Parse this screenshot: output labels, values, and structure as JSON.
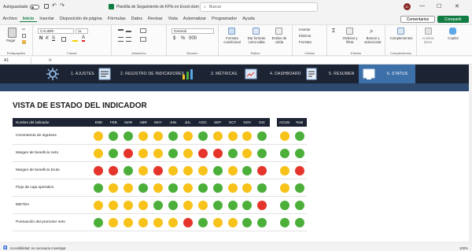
{
  "titlebar": {
    "autosave": "Autoguardado",
    "doc_title": "Plantilla de Seguimiento de KPIs en Excel.xlsm - Solo lec...",
    "search_placeholder": "Buscar",
    "avatar_initials": "JL"
  },
  "tabs": [
    "Archivo",
    "Inicio",
    "Insertar",
    "Disposición de página",
    "Fórmulas",
    "Datos",
    "Revisar",
    "Vista",
    "Automatizar",
    "Programador",
    "Ayuda"
  ],
  "active_tab": "Inicio",
  "actions": {
    "comments": "Comentarios",
    "share": "Compartir"
  },
  "ribbon": {
    "clipboard": {
      "paste": "Pegar",
      "label": "Portapapeles"
    },
    "font": {
      "name": "CALIBRI",
      "size": "11",
      "label": "Fuente"
    },
    "alignment": {
      "label": "Alineación"
    },
    "number": {
      "format": "General",
      "label": "Número"
    },
    "styles": {
      "conditional": "Formato condicional",
      "table": "Dar formato como tabla",
      "cell": "Estilos de celda",
      "label": "Estilos"
    },
    "cells": {
      "insert": "Insertar",
      "delete": "Eliminar",
      "format": "Formato",
      "label": "Celdas"
    },
    "editing": {
      "sort": "Ordenar y filtrar",
      "find": "Buscar y seleccionar",
      "label": "Edición"
    },
    "addins": {
      "addins": "Complementos",
      "label": "Complementos"
    },
    "data_analysis": "Analizar datos",
    "copilot": "Copilot"
  },
  "formula_bar": {
    "cell_ref": "A1",
    "fx": "fx"
  },
  "nav": {
    "items": [
      {
        "label": "1. AJUSTES"
      },
      {
        "label": "2. REGISTRO DE INDICADORES"
      },
      {
        "label": "3. MÉTRICAS"
      },
      {
        "label": "4. DASHBOARD"
      },
      {
        "label": "5. RESUMEN"
      },
      {
        "label": "6. STATUS"
      }
    ],
    "active_index": 5
  },
  "page_title": "VISTA DE ESTADO DEL INDICADOR",
  "table": {
    "name_header": "Nombre del indicador",
    "months": [
      "ENE",
      "FEB",
      "MAR",
      "ABR",
      "MAY",
      "JUN",
      "JUL",
      "AGO",
      "SEP",
      "OCT",
      "NOV",
      "DIC"
    ],
    "acum_header": "ACUM",
    "total_header": "Total",
    "rows": [
      {
        "name": "Crecimiento de ingresos",
        "status": [
          "y",
          "g",
          "g",
          "y",
          "y",
          "g",
          "y",
          "g",
          "y",
          "y",
          "y",
          "g"
        ],
        "acum": "y",
        "total": "g"
      },
      {
        "name": "Margen de beneficio neto",
        "status": [
          "y",
          "g",
          "r",
          "y",
          "y",
          "g",
          "y",
          "r",
          "r",
          "g",
          "y",
          "g"
        ],
        "acum": "g",
        "total": "g"
      },
      {
        "name": "Margen de beneficio bruto",
        "status": [
          "r",
          "r",
          "g",
          "y",
          "r",
          "y",
          "y",
          "y",
          "g",
          "y",
          "g",
          "r"
        ],
        "acum": "y",
        "total": "r"
      },
      {
        "name": "Flujo de caja operativo",
        "status": [
          "g",
          "y",
          "y",
          "g",
          "y",
          "g",
          "y",
          "g",
          "g",
          "y",
          "y",
          "g"
        ],
        "acum": "y",
        "total": "g"
      },
      {
        "name": "EBITDA",
        "status": [
          "y",
          "y",
          "y",
          "y",
          "g",
          "g",
          "y",
          "y",
          "g",
          "g",
          "g",
          "r"
        ],
        "acum": "g",
        "total": "g"
      },
      {
        "name": "Puntuación del promotor neto",
        "status": [
          "g",
          "y",
          "y",
          "y",
          "y",
          "y",
          "r",
          "g",
          "y",
          "y",
          "g",
          "g"
        ],
        "acum": "g",
        "total": "g"
      }
    ]
  },
  "colors": {
    "g": "#4caf3a",
    "y": "#f7c21a",
    "r": "#e5352b",
    "navbar": "#1c2333",
    "active_nav": "#3d6fa8",
    "accent": "#107c41"
  },
  "status": {
    "accessibility": "Accesibilidad: es necesario investigar",
    "zoom": "100%"
  }
}
